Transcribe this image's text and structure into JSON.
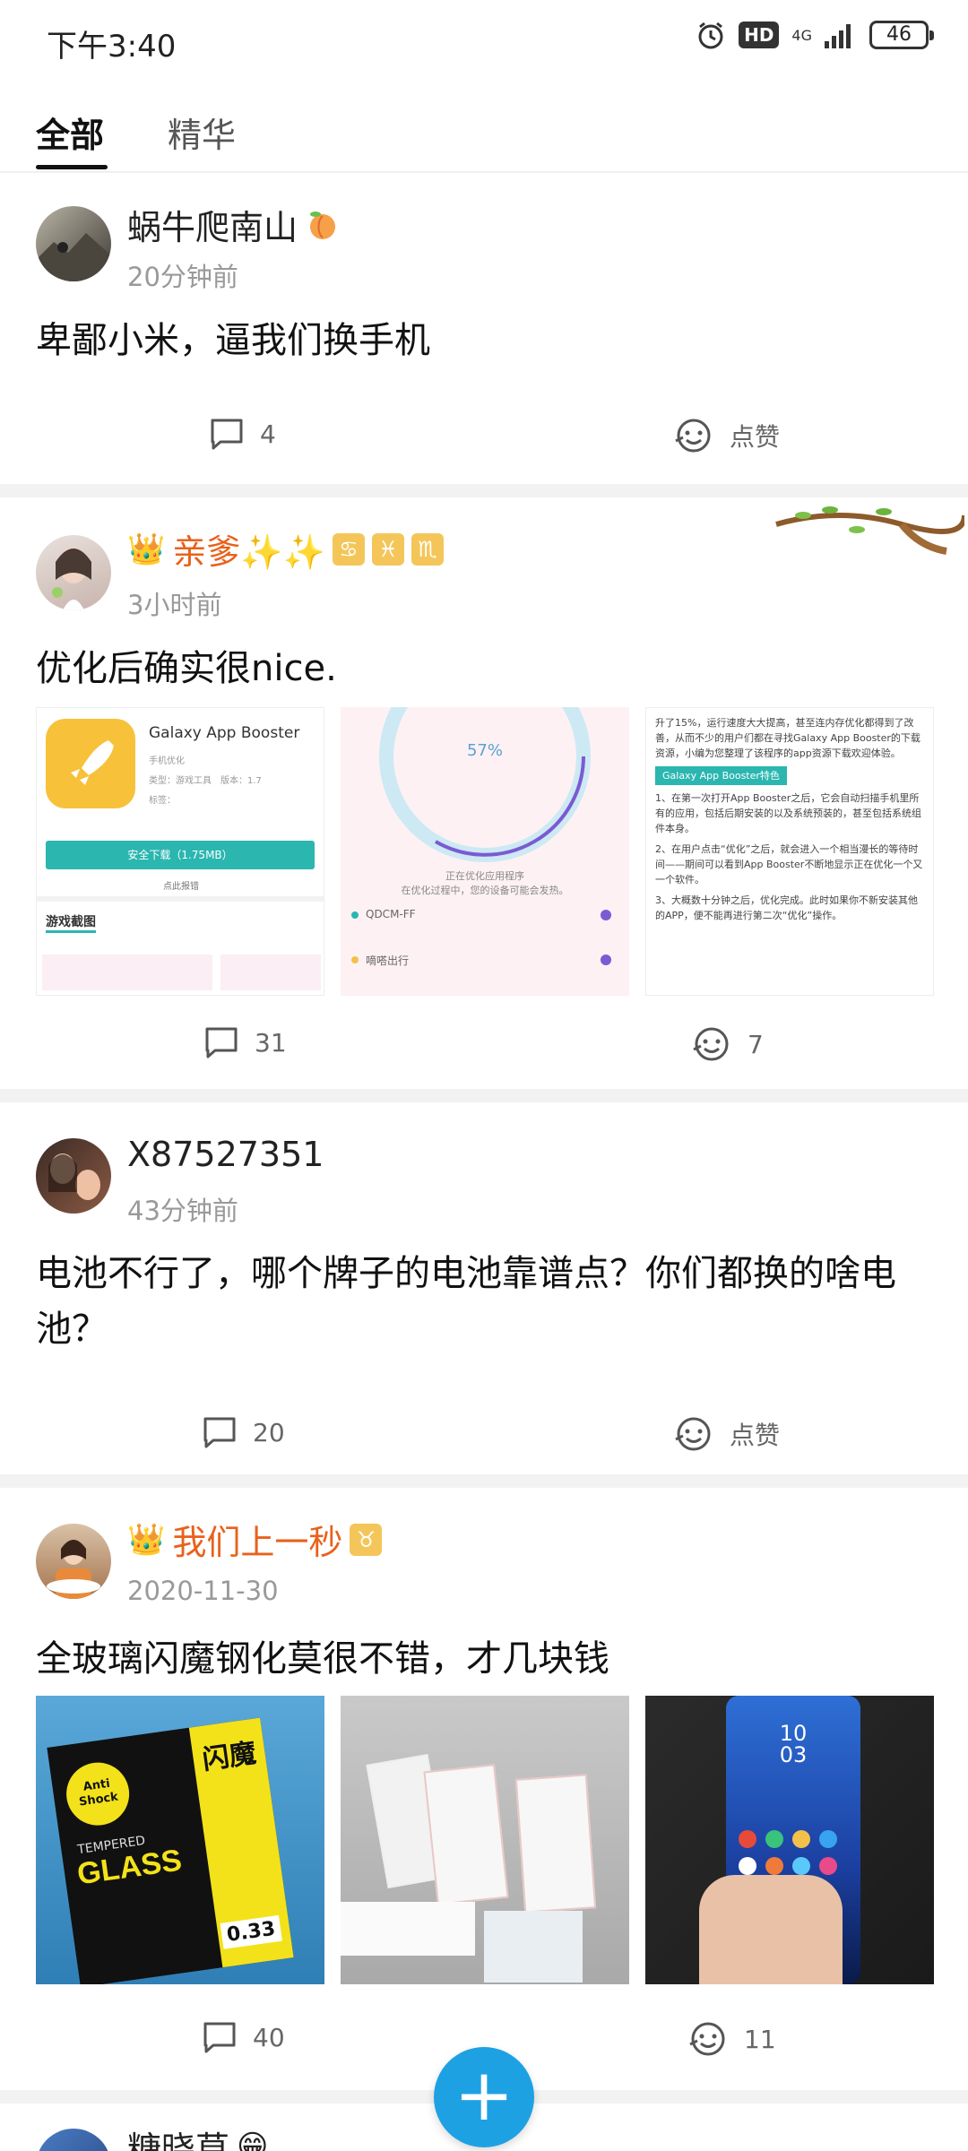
{
  "status": {
    "time": "下午3:40",
    "hd": "HD",
    "network": "4G",
    "battery": "46"
  },
  "tabs": [
    {
      "label": "全部"
    },
    {
      "label": "精华"
    }
  ],
  "posts": [
    {
      "author": "蜗牛爬南山",
      "time": "20分钟前",
      "content": "卑鄙小米，逼我们换手机",
      "comments": "4",
      "likes": "点赞"
    },
    {
      "author": "亲爹✨✨",
      "time": "3小时前",
      "content": "优化后确实很nice.",
      "comments": "31",
      "likes": "7",
      "shot1": {
        "app": "Galaxy App Booster",
        "sub1": "手机优化",
        "sub2": "类型：游戏工具　版本：1.7",
        "sub3": "标签：",
        "download": "安全下载（1.75MB）",
        "report": "点此报错",
        "section": "游戏截图"
      },
      "shot2": {
        "percent": "57%",
        "line1": "正在优化应用程序",
        "line2": "在优化过程中，您的设备可能会发热。",
        "row1": "QDCM-FF",
        "row2": "嘀嗒出行"
      },
      "shot3": {
        "p1": "升了15%，运行速度大大提高，甚至连内存优化都得到了改善，从而不少的用户们都在寻找Galaxy App Booster的下载资源，小编为您整理了该程序的app资源下载欢迎体验。",
        "tag": "Galaxy App Booster特色",
        "p2": "1、在第一次打开App Booster之后，它会自动扫描手机里所有的应用，包括后期安装的以及系统预装的，甚至包括系统组件本身。",
        "p3": "2、在用户点击“优化”之后，就会进入一个相当漫长的等待时间——期间可以看到App Booster不断地显示正在优化一个又一个软件。",
        "p4": "3、大概数十分钟之后，优化完成。此时如果你不新安装其他的APP，便不能再进行第二次“优化”操作。"
      }
    },
    {
      "author": "X87527351",
      "time": "43分钟前",
      "content": "电池不行了，哪个牌子的电池靠谱点？你们都换的啥电池？",
      "comments": "20",
      "likes": "点赞"
    },
    {
      "author": "我们上一秒",
      "time": "2020-11-30",
      "content": "全玻璃闪魔钢化莫很不错，才几块钱",
      "comments": "40",
      "likes": "11",
      "glass": {
        "brand": "闪魔",
        "tempered": "TEMPERED",
        "word": "GLASS",
        "anti": "Anti Shock",
        "thick": "0.33"
      },
      "phone": {
        "time": "10\n03"
      }
    },
    {
      "author": "糖晓草"
    }
  ],
  "fab": {
    "label": "+"
  },
  "colors": {
    "accent": "#1ea1e3",
    "vip_name": "#e8611c"
  }
}
